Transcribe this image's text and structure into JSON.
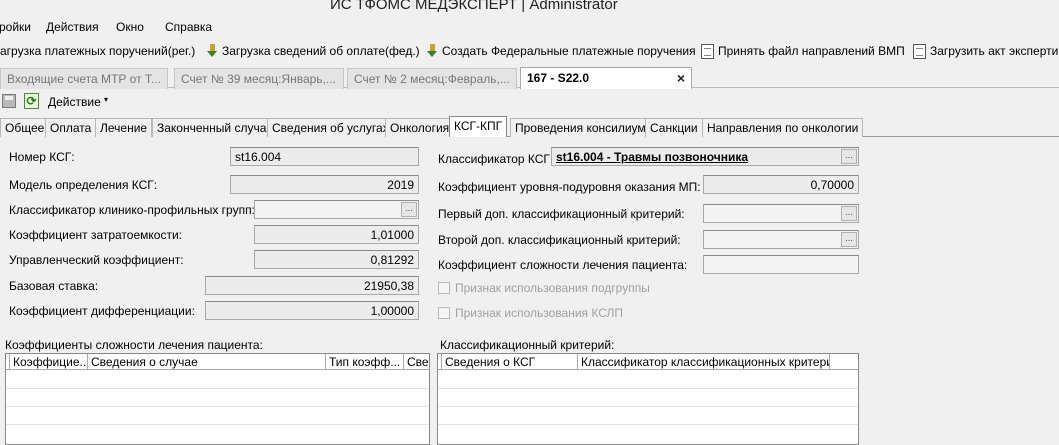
{
  "window": {
    "title": "ИС ТФОМС МЕДЭКСПЕРТ | Administrator"
  },
  "menu": {
    "items": [
      "ройки",
      "Действия",
      "Окно",
      "Справка"
    ]
  },
  "toolbar": {
    "items": [
      {
        "label": "агрузка платежных поручений(рег.)",
        "icon": ""
      },
      {
        "label": "Загрузка сведений об оплате(фед.)",
        "icon": "download-icon"
      },
      {
        "label": "Создать Федеральные платежные поручения",
        "icon": "download-icon"
      },
      {
        "label": "Принять файл направлений ВМП",
        "icon": "document-icon"
      },
      {
        "label": "Загрузить акт эксперти",
        "icon": "document-icon"
      }
    ]
  },
  "doc_tabs": [
    {
      "label": "Входящие счета МТР от Т..."
    },
    {
      "label": "Счет № 39 месяц:Январь,..."
    },
    {
      "label": "Счет № 2 месяц:Февраль,..."
    },
    {
      "label": "167 - S22.0",
      "active": true,
      "close": "×"
    }
  ],
  "action_bar": {
    "label": "Действие",
    "arrow": "▾"
  },
  "sub_tabs": [
    {
      "label": "Общее"
    },
    {
      "label": "Оплата"
    },
    {
      "label": "Лечение"
    },
    {
      "label": "Законченный случай"
    },
    {
      "label": "Сведения об услугах"
    },
    {
      "label": "Онкология"
    },
    {
      "label": "КСГ-КПГ",
      "active": true
    },
    {
      "label": "Проведения консилиума"
    },
    {
      "label": "Санкции"
    },
    {
      "label": "Направления по онкологии"
    }
  ],
  "left_fields": [
    {
      "label": "Номер КСГ:",
      "value": "st16.004"
    },
    {
      "label": "Модель определения КСГ:",
      "value": "2019"
    },
    {
      "label": "Классификатор клинико-профильных групп:",
      "value": ""
    },
    {
      "label": "Коэффициент затратоемкости:",
      "value": "1,01000"
    },
    {
      "label": "Управленческий коэффициент:",
      "value": "0,81292"
    },
    {
      "label": "Базовая ставка:",
      "value": "21950,38"
    },
    {
      "label": "Коэффициент дифференциации:",
      "value": "1,00000"
    }
  ],
  "right_fields": [
    {
      "label": "Классификатор КСГ:",
      "value": "st16.004 - Травмы позвоночника"
    },
    {
      "label": "Коэффициент уровня-подуровня оказания МП:",
      "value": "0,70000"
    },
    {
      "label": "Первый доп. классификационный критерий:",
      "value": ""
    },
    {
      "label": "Второй доп. классификационный критерий:",
      "value": ""
    },
    {
      "label": "Коэффициент сложности лечения пациента:",
      "value": ""
    }
  ],
  "checkboxes": [
    {
      "label": "Признак использования подгруппы",
      "checked": false
    },
    {
      "label": "Признак использования КСЛП",
      "checked": false
    }
  ],
  "grid_left": {
    "title": "Коэффициенты сложности лечения пациента:",
    "columns": [
      "Коэффицие...",
      "Сведения о случае",
      "Тип коэфф...",
      "Све"
    ]
  },
  "grid_right": {
    "title": "Классификационный критерий:",
    "columns": [
      "Сведения о КСГ",
      "Классификатор классификационных критериев"
    ]
  },
  "colors": {
    "accent_underline": "#e0201c",
    "window_bg": "#f0f0f0"
  }
}
